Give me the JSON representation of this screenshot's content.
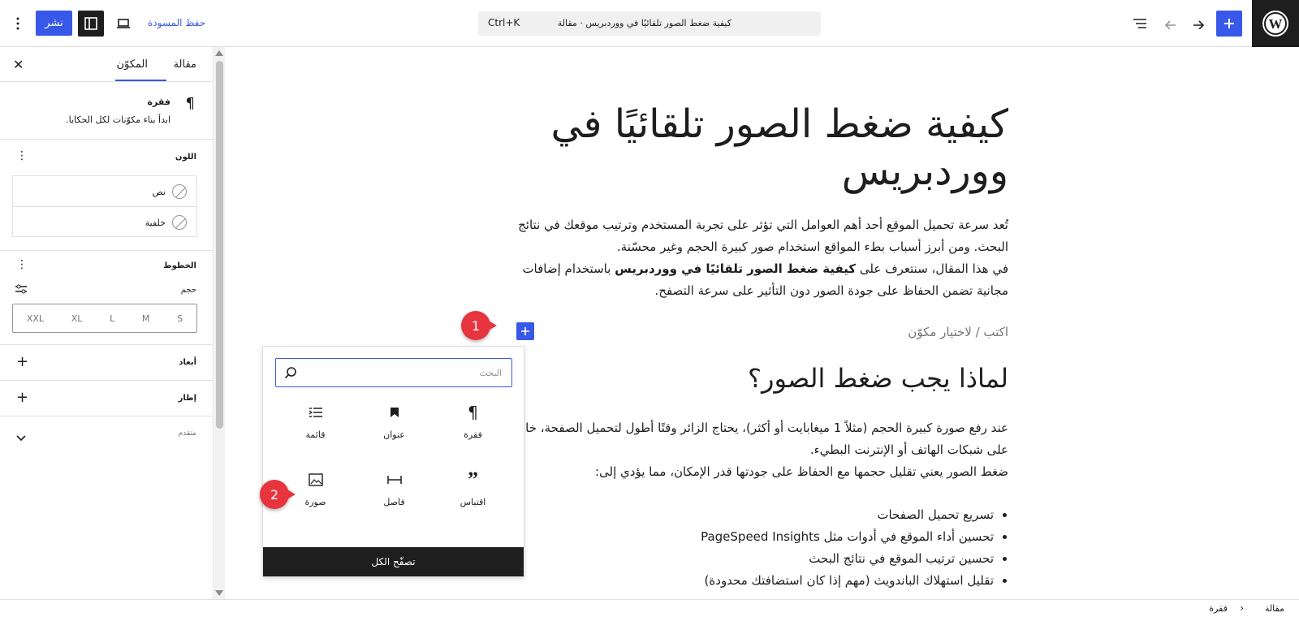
{
  "topbar": {
    "document_title": "كيفية ضغط الصور تلقائيًا في ووردبريس · مقالة",
    "shortcut": "Ctrl+K",
    "save_draft": "حفظ المسودة",
    "publish": "نشر"
  },
  "sidebar": {
    "tabs": [
      "مقالة",
      "المكوّن"
    ],
    "active_tab": "المكوّن",
    "block": {
      "name": "فقرة",
      "description": "ابدأ بناء مكوّنات لكل الحكايا."
    },
    "color": {
      "title": "اللون",
      "text": "نص",
      "background": "خلفية"
    },
    "typography": {
      "title": "الخطوط",
      "size_label": "حجم",
      "sizes": [
        "XXL",
        "XL",
        "L",
        "M",
        "S"
      ]
    },
    "dimensions": "أبعاد",
    "border": "إطار",
    "advanced": "متقدم"
  },
  "canvas": {
    "title": "كيفية ضغط الصور تلقائيًا في ووردبريس",
    "intro_1": "تُعد سرعة تحميل الموقع أحد أهم العوامل التي تؤثر على تجربة المستخدم وترتيب موقعك في نتائج البحث. ومن أبرز أسباب بطء المواقع استخدام صور كبيرة الحجم وغير محسّنة.",
    "intro_2_pre": "في هذا المقال، سنتعرف على ",
    "intro_2_bold": "كيفية ضغط الصور تلقائيًا في ووردبريس",
    "intro_2_post": " باستخدام إضافات مجانية تضمن الحفاظ على جودة الصور دون التأثير على سرعة التصفح.",
    "placeholder": "اكتب / لاختيار مكوّن",
    "heading": "لماذا يجب ضغط الصور؟",
    "para_1": "عند رفع صورة كبيرة الحجم (مثلاً 1 ميغابايت أو أكثر)، يحتاج الزائر وقتًا أطول لتحميل الصفحة، خاصةً على شبكات الهاتف أو الإنترنت البطيء.",
    "para_2": "ضغط الصور يعني تقليل حجمها مع الحفاظ على جودتها قدر الإمكان، مما يؤدي إلى:",
    "bullets": [
      "تسريع تحميل الصفحات",
      "تحسين أداء الموقع في أدوات مثل PageSpeed Insights",
      "تحسين ترتيب الموقع في نتائج البحث",
      "تقليل استهلاك الباندويث (مهم إذا كان استضافتك محدودة)"
    ]
  },
  "inserter": {
    "search_placeholder": "البحث",
    "blocks": [
      {
        "name": "فقرة",
        "icon": "paragraph-icon"
      },
      {
        "name": "عنوان",
        "icon": "bookmark-icon"
      },
      {
        "name": "قائمة",
        "icon": "list-icon"
      },
      {
        "name": "اقتباس",
        "icon": "quote-icon"
      },
      {
        "name": "فاصل",
        "icon": "separator-icon"
      },
      {
        "name": "صورة",
        "icon": "image-icon"
      }
    ],
    "browse_all": "تصفّح الكل"
  },
  "annotations": [
    "1",
    "2"
  ],
  "breadcrumb": [
    "مقالة",
    "فقرة"
  ],
  "colors": {
    "accent": "#3858e9",
    "dark": "#1e1e1e",
    "badge": "#e7343f"
  }
}
